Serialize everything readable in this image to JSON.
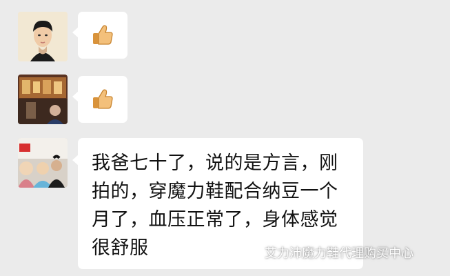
{
  "messages": [
    {
      "type": "emoji",
      "emoji": "thumbs-up-icon"
    },
    {
      "type": "emoji",
      "emoji": "thumbs-up-icon"
    },
    {
      "type": "text",
      "text": "我爸七十了，说的是方言，刚拍的，穿魔力鞋配合纳豆一个月了，血压正常了，身体感觉很舒服"
    }
  ],
  "watermark": {
    "text": "艾力沛魔力鞋代理购买中心"
  },
  "colors": {
    "background": "#ebebeb",
    "bubble": "#ffffff",
    "text": "#111111"
  }
}
